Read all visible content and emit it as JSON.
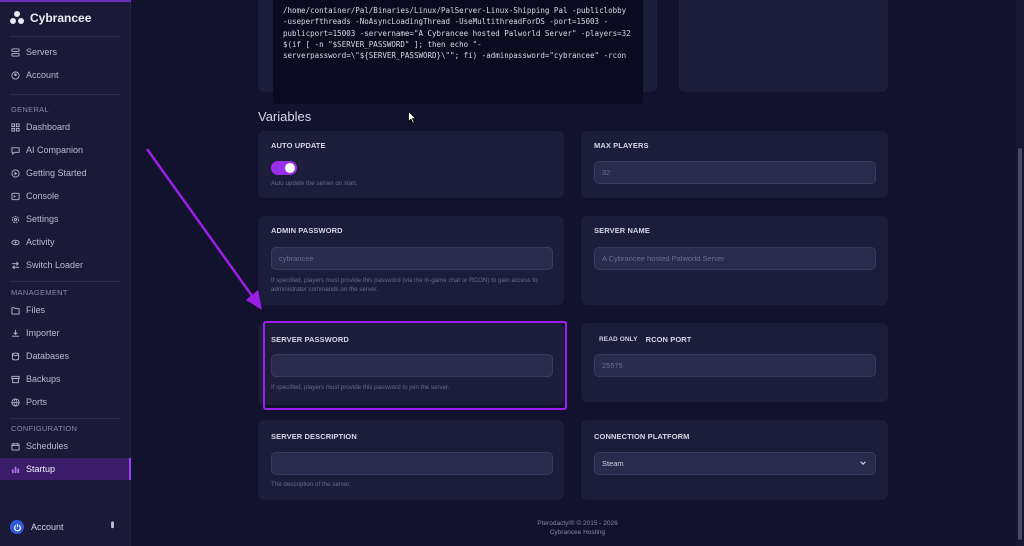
{
  "brand": {
    "name": "Cybrancee"
  },
  "sidebar": {
    "top_items": [
      {
        "label": "Servers",
        "icon": "servers-icon"
      },
      {
        "label": "Account",
        "icon": "account-icon"
      }
    ],
    "general_heading": "GENERAL",
    "general_items": [
      {
        "label": "Dashboard",
        "icon": "dashboard-icon"
      },
      {
        "label": "AI Companion",
        "icon": "ai-companion-icon"
      },
      {
        "label": "Getting Started",
        "icon": "getting-started-icon"
      },
      {
        "label": "Console",
        "icon": "console-icon"
      },
      {
        "label": "Settings",
        "icon": "settings-icon"
      },
      {
        "label": "Activity",
        "icon": "activity-icon"
      },
      {
        "label": "Switch Loader",
        "icon": "switch-loader-icon"
      }
    ],
    "management_heading": "MANAGEMENT",
    "management_items": [
      {
        "label": "Files",
        "icon": "files-icon"
      },
      {
        "label": "Importer",
        "icon": "importer-icon"
      },
      {
        "label": "Databases",
        "icon": "databases-icon"
      },
      {
        "label": "Backups",
        "icon": "backups-icon"
      },
      {
        "label": "Ports",
        "icon": "ports-icon"
      }
    ],
    "configuration_heading": "CONFIGURATION",
    "configuration_items": [
      {
        "label": "Schedules",
        "icon": "schedules-icon"
      },
      {
        "label": "Startup",
        "icon": "startup-icon",
        "active": true
      }
    ],
    "account_label": "Account"
  },
  "startup_command": "/home/container/Pal/Binaries/Linux/PalServer-Linux-Shipping Pal -publiclobby -useperfthreads -NoAsyncLoadingThread -UseMultithreadForDS -port=15003 -publicport=15003 -servername=\"A Cybrancee hosted Palworld Server\" -players=32 $(if [ -n \"$SERVER_PASSWORD\" ]; then echo \"-serverpassword=\\\"${SERVER_PASSWORD}\\\"\"; fi) -adminpassword=\"cybrancee\" -rcon",
  "variables": {
    "title": "Variables",
    "auto_update": {
      "label": "AUTO UPDATE",
      "enabled": true,
      "help": "Auto update the server on start."
    },
    "max_players": {
      "label": "MAX PLAYERS",
      "value": "32"
    },
    "admin_password": {
      "label": "ADMIN PASSWORD",
      "value": "cybrancee",
      "help": "If specified, players must provide this password (via the in-game chat or RCON) to gain access to administrator commands on the server."
    },
    "server_name": {
      "label": "SERVER NAME",
      "value": "A Cybrancee hosted Palworld Server"
    },
    "server_password": {
      "label": "SERVER PASSWORD",
      "value": "",
      "help": "If specified, players must provide this password to join the server."
    },
    "rcon_port": {
      "badge": "READ ONLY",
      "label": "RCON PORT",
      "value": "25575"
    },
    "server_description": {
      "label": "SERVER DESCRIPTION",
      "value": "",
      "help": "The description of the server."
    },
    "connection_platform": {
      "label": "CONNECTION PLATFORM",
      "value": "Steam"
    }
  },
  "footer": {
    "line1": "Pterodactyl® © 2015 - 2026",
    "line2": "Cybrancee Hosting"
  },
  "colors": {
    "accent": "#9b2ff0",
    "highlight": "#a01ff0",
    "background": "#12122e",
    "card": "#1c1c3b"
  }
}
